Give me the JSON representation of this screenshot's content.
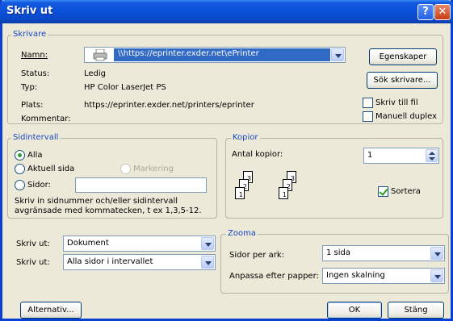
{
  "window": {
    "title": "Skriv ut",
    "help_label": "?",
    "close_label": "✕"
  },
  "printer": {
    "legend": "Skrivare",
    "name_label": "Namn:",
    "name_value": "\\\\https://eprinter.exder.net\\ePrinter",
    "status_label": "Status:",
    "status_value": "Ledig",
    "type_label": "Typ:",
    "type_value": "HP Color LaserJet PS",
    "location_label": "Plats:",
    "location_value": "https://eprinter.exder.net/printers/eprinter",
    "comment_label": "Kommentar:",
    "comment_value": "",
    "properties_button": "Egenskaper",
    "find_button": "Sök skrivare...",
    "print_to_file_label": "Skriv till fil",
    "print_to_file_checked": false,
    "manual_duplex_label": "Manuell duplex",
    "manual_duplex_checked": false
  },
  "page_range": {
    "legend": "Sidintervall",
    "all_label": "Alla",
    "current_label": "Aktuell sida",
    "selection_label": "Markering",
    "pages_label": "Sidor:",
    "pages_value": "",
    "selected": "all",
    "hint_line1": "Skriv in sidnummer och/eller sidintervall",
    "hint_line2": "avgränsade med kommatecken, t ex 1,3,5-12."
  },
  "copies": {
    "legend": "Kopior",
    "count_label": "Antal kopior:",
    "count_value": "1",
    "collate_label": "Sortera",
    "collate_checked": true,
    "page_numbers": [
      "1",
      "2",
      "3"
    ]
  },
  "print_what": {
    "label": "Skriv ut:",
    "value": "Dokument"
  },
  "print_pages": {
    "label": "Skriv ut:",
    "value": "Alla sidor i intervallet"
  },
  "zoom": {
    "legend": "Zooma",
    "pages_per_sheet_label": "Sidor per ark:",
    "pages_per_sheet_value": "1 sida",
    "scale_label": "Anpassa efter papper:",
    "scale_value": "Ingen skalning"
  },
  "footer": {
    "options_button": "Alternativ...",
    "ok_button": "OK",
    "cancel_button": "Stäng"
  },
  "colors": {
    "titlebar": "#0a4fd7",
    "face": "#ece9d8",
    "legend_text": "#1a46c5",
    "name_highlight": "#316ac5"
  }
}
